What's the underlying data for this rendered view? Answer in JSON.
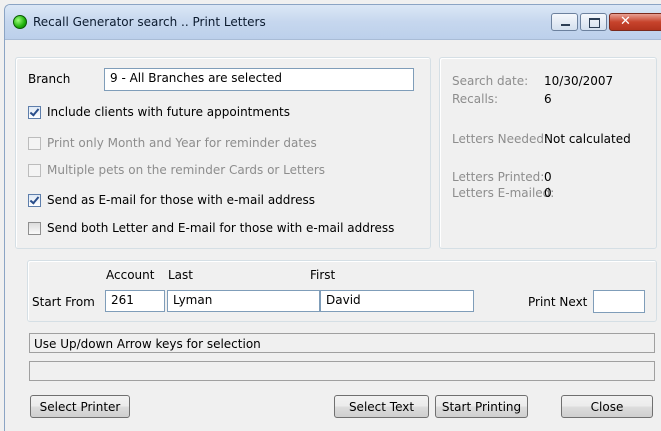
{
  "window": {
    "title": "Recall Generator search .. Print Letters",
    "app_icon": "green-status-dot",
    "controls": {
      "minimize": "minimize-icon",
      "maximize": "maximize-icon",
      "close": "close-icon",
      "close_glyph": "✕"
    }
  },
  "options": {
    "branch_label": "Branch",
    "branch_value": "9  - All Branches are selected",
    "checkboxes": [
      {
        "label": "Include clients with future appointments",
        "checked": true,
        "enabled": true
      },
      {
        "label": "Print only Month and Year for reminder dates",
        "checked": false,
        "enabled": false
      },
      {
        "label": "Multiple pets on the reminder Cards or Letters",
        "checked": false,
        "enabled": false
      },
      {
        "label": "Send as E-mail for those with e-mail address",
        "checked": true,
        "enabled": true
      },
      {
        "label": "Send both Letter and E-mail for those with e-mail address",
        "checked": false,
        "enabled": true
      }
    ]
  },
  "summary": {
    "search_date_label": "Search date:",
    "search_date_value": "10/30/2007",
    "recalls_label": "Recalls:",
    "recalls_value": "6",
    "letters_needed_label": "Letters Needed:",
    "letters_needed_value": "Not calculated",
    "letters_printed_label": "Letters Printed:",
    "letters_printed_value": "0",
    "letters_emailed_label": "Letters E-mailed:",
    "letters_emailed_value": "0"
  },
  "start_from": {
    "label": "Start From",
    "account_header": "Account",
    "last_header": "Last",
    "first_header": "First",
    "account_value": "261",
    "last_value": "Lyman",
    "first_value": "David",
    "print_next_label": "Print Next",
    "print_next_value": ""
  },
  "status": {
    "hint": "Use Up/down Arrow keys for selection",
    "second_line": ""
  },
  "buttons": {
    "select_printer": "Select Printer",
    "select_text": "Select Text",
    "start_printing": "Start Printing",
    "close": "Close"
  },
  "colors": {
    "title_bar": "#c6d7ee",
    "close_button": "#c7432c",
    "disabled_text": "#8d8d8d",
    "checkbox_check": "#2a4e8b"
  }
}
